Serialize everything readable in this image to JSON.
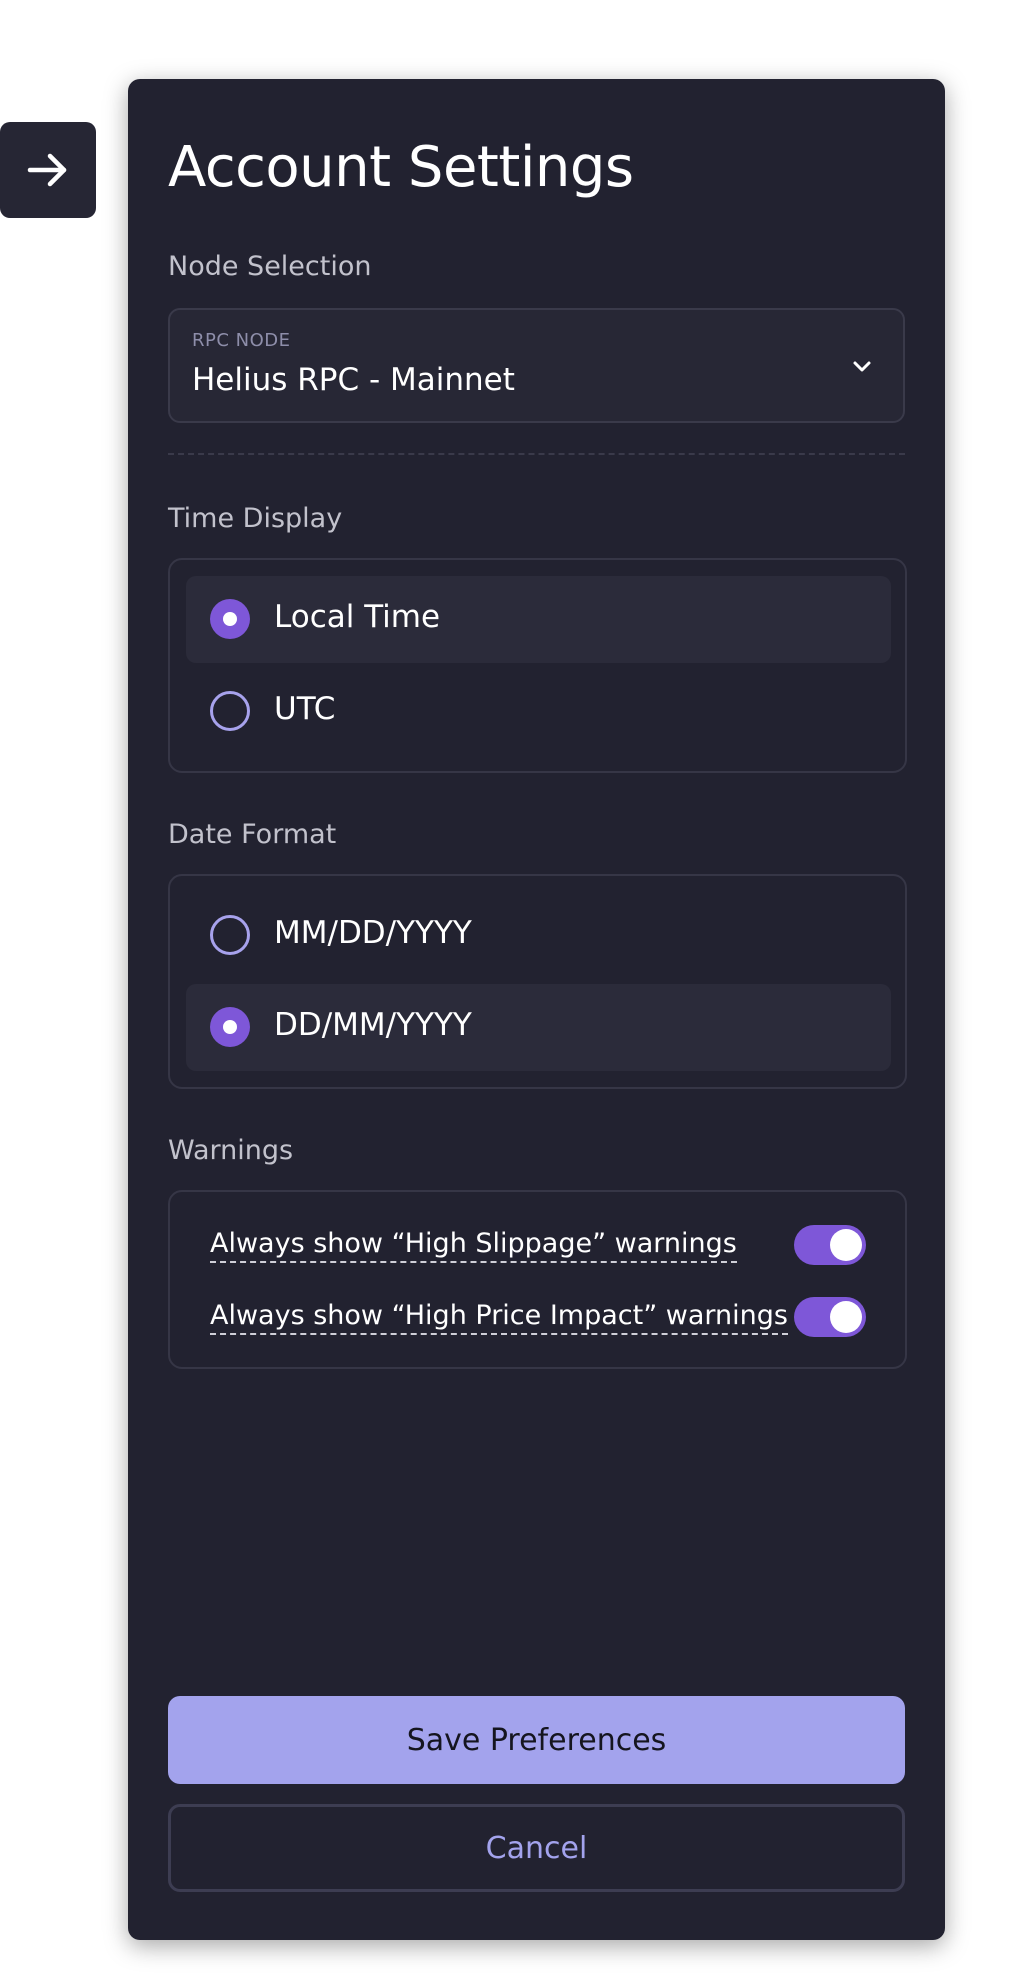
{
  "sidebar_toggle": {
    "icon": "arrow-right-icon"
  },
  "panel": {
    "title": "Account Settings",
    "node_selection": {
      "label": "Node Selection",
      "select_caption": "RPC NODE",
      "selected_value": "Helius RPC - Mainnet",
      "icon": "chevron-down-icon"
    },
    "time_display": {
      "label": "Time Display",
      "options": [
        {
          "label": "Local Time",
          "selected": true
        },
        {
          "label": "UTC",
          "selected": false
        }
      ]
    },
    "date_format": {
      "label": "Date Format",
      "options": [
        {
          "label": "MM/DD/YYYY",
          "selected": false
        },
        {
          "label": "DD/MM/YYYY",
          "selected": true
        }
      ]
    },
    "warnings": {
      "label": "Warnings",
      "items": [
        {
          "label": "Always show “High Slippage” warnings",
          "enabled": true
        },
        {
          "label": "Always show “High Price Impact” warnings",
          "enabled": true
        }
      ]
    },
    "actions": {
      "save_label": "Save Preferences",
      "cancel_label": "Cancel"
    }
  },
  "colors": {
    "panel_bg": "#222230",
    "accent": "#7e57d8",
    "primary_button": "#a3a3ed",
    "page_bg": "#ffffff"
  }
}
